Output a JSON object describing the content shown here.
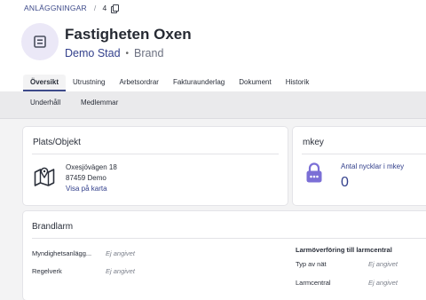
{
  "breadcrumb": {
    "section": "ANLÄGGNINGAR",
    "separator": "/",
    "id": "4"
  },
  "header": {
    "title": "Fastigheten Oxen",
    "location": "Demo Stad",
    "separator": "•",
    "category": "Brand"
  },
  "tabs": [
    "Översikt",
    "Utrustning",
    "Arbetsordrar",
    "Fakturaunderlag",
    "Dokument",
    "Historik"
  ],
  "subtabs": [
    "Underhåll",
    "Medlemmar"
  ],
  "location_card": {
    "title": "Plats/Objekt",
    "street": "Oxesjövägen 18",
    "postal": "87459 Demo",
    "map_link": "Visa på karta"
  },
  "mkey_card": {
    "title": "mkey",
    "label": "Antal nycklar i mkey",
    "value": "0"
  },
  "brandlarm": {
    "title": "Brandlarm",
    "rows": [
      {
        "label": "Myndighetsanlägg...",
        "value": "Ej angivet"
      },
      {
        "label": "Regelverk",
        "value": "Ej angivet"
      }
    ],
    "transfer": {
      "heading": "Larmöverföring till larmcentral",
      "rows": [
        {
          "label": "Typ av nät",
          "value": "Ej angivet"
        },
        {
          "label": "Larmcentral",
          "value": "Ej angivet"
        }
      ]
    }
  },
  "colors": {
    "accent": "#33408c",
    "avatar_bg": "#ebe8f7",
    "mkey_icon": "#7b6fd6"
  }
}
